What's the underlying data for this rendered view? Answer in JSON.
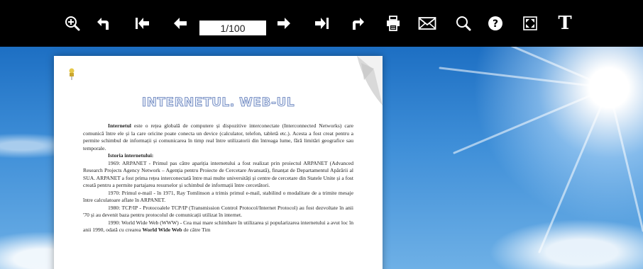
{
  "toolbar": {
    "page_indicator": "1/100",
    "buttons": [
      {
        "name": "zoom-in"
      },
      {
        "name": "back"
      },
      {
        "name": "first-page"
      },
      {
        "name": "previous-page"
      },
      {
        "name": "next-page"
      },
      {
        "name": "last-page"
      },
      {
        "name": "forward"
      },
      {
        "name": "print"
      },
      {
        "name": "email"
      },
      {
        "name": "search"
      },
      {
        "name": "help"
      },
      {
        "name": "fullscreen"
      },
      {
        "name": "text"
      }
    ],
    "text_button_label": "T",
    "help_button_label": "?"
  },
  "document": {
    "title": "INTERNETUL. WEB-UL",
    "paragraphs": [
      {
        "bold_lead": "Internetul",
        "text": " este o rețea globală de computere și dispozitive interconectate (Interconnected Networks) care comunică între ele și la care oricine poate conecta un device (calculator, telefon, tabletă etc.). Acesta a fost creat pentru a permite schimbul de informații și comunicarea în timp real între utilizatorii din întreaga lume, fără limitări geografice sau temporale."
      },
      {
        "heading": "Istoria internetului:"
      },
      {
        "text": "1969: ARPANET - Primul pas către apariția internetului a fost realizat prin proiectul ARPANET (Advanced Research Projects Agency Network – Agenția pentru Proiecte de Cercetare Avansată), finanțat de Departamentul Apărării al SUA. ARPANET a fost prima rețea interconectată între mai multe universități și centre de cercetare din Statele Unite și a fost creată pentru a permite partajarea resurselor și schimbul de informații între cercetători."
      },
      {
        "text": "1970: Primul e-mail - în 1971, Ray Tomlinson a trimis primul e-mail, stabilind o modalitate de a trimite mesaje între calculatoare aflate în ARPANET."
      },
      {
        "text": "1980: TCP/IP - Protocoalele TCP/IP (Transmission Control Protocol/Internet Protocol) au fost dezvoltate în anii '70 și au devenit baza pentru protocolul de comunicații utilizat în internet."
      },
      {
        "text": "1990: World Wide Web (WWW) - Cea mai mare schimbare în utilizarea și popularizarea internetului a avut loc în anii 1990, odată cu crearea ",
        "bold_tail": "World Wide Web",
        "text_after": " de către Tim"
      }
    ]
  }
}
